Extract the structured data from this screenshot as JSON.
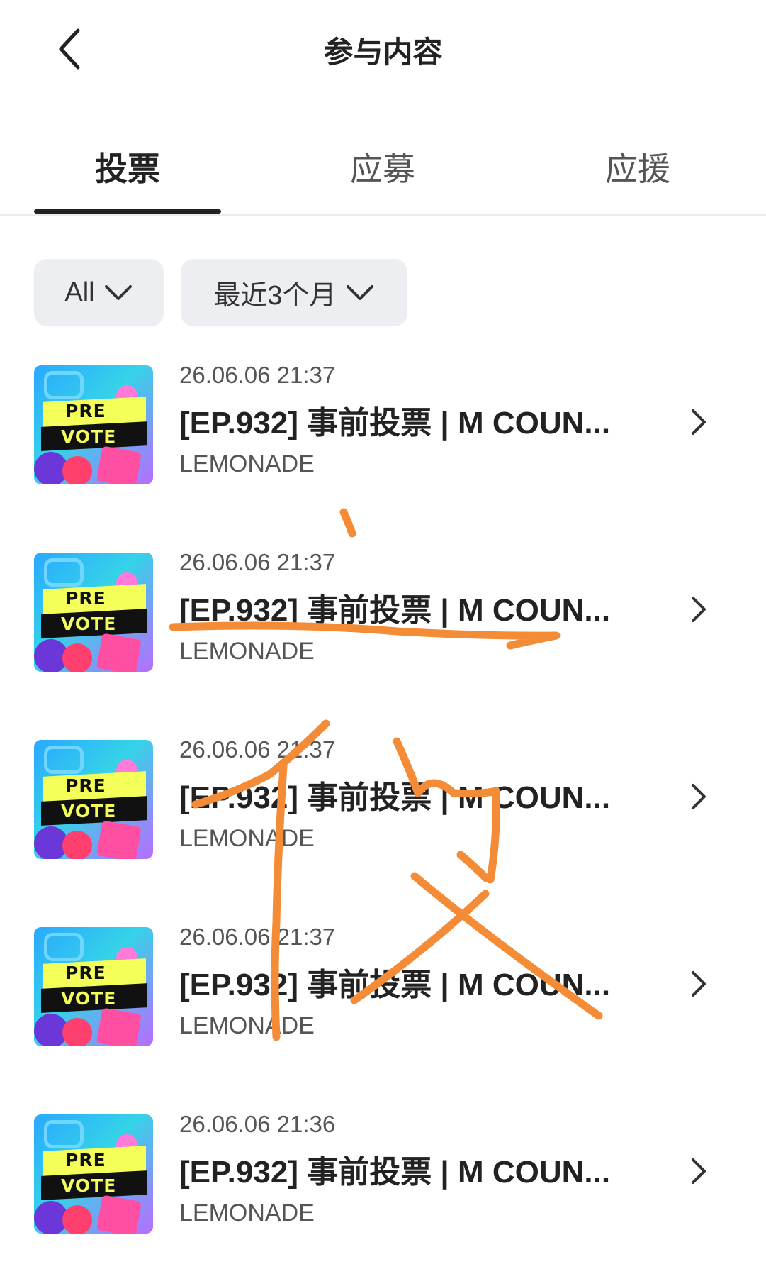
{
  "header": {
    "title": "参与内容"
  },
  "tabs": [
    {
      "label": "投票",
      "active": true
    },
    {
      "label": "应募",
      "active": false
    },
    {
      "label": "应援",
      "active": false
    }
  ],
  "filters": {
    "type": "All",
    "period": "最近3个月"
  },
  "thumbnail": {
    "line1": "PRE",
    "line2": "VOTE"
  },
  "items": [
    {
      "date": "26.06.06 21:37",
      "title": "[EP.932] 事前投票 | M COUN...",
      "source": "LEMONADE"
    },
    {
      "date": "26.06.06 21:37",
      "title": "[EP.932] 事前投票 | M COUN...",
      "source": "LEMONADE"
    },
    {
      "date": "26.06.06 21:37",
      "title": "[EP.932] 事前投票 | M COUN...",
      "source": "LEMONADE"
    },
    {
      "date": "26.06.06 21:37",
      "title": "[EP.932] 事前投票 | M COUN...",
      "source": "LEMONADE"
    },
    {
      "date": "26.06.06 21:36",
      "title": "[EP.932] 事前投票 | M COUN...",
      "source": "LEMONADE"
    }
  ],
  "colors": {
    "scribble": "#f48b36",
    "text": "#222222",
    "chip_bg": "#eceef1"
  }
}
